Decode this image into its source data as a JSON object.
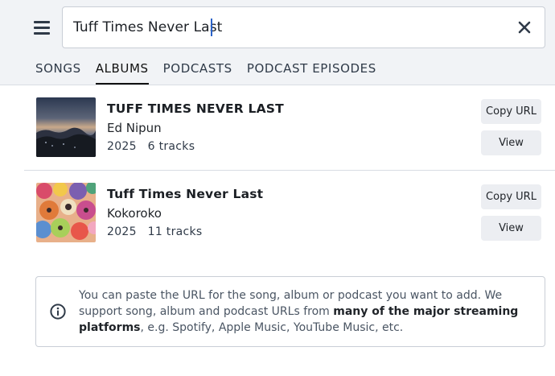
{
  "header": {
    "menu_icon": "hamburger-menu-icon",
    "search": {
      "value": "Tuff Times Never Last",
      "clear_icon": "close-icon"
    }
  },
  "tabs": [
    {
      "label": "SONGS",
      "active": false
    },
    {
      "label": "ALBUMS",
      "active": true
    },
    {
      "label": "PODCASTS",
      "active": false
    },
    {
      "label": "PODCAST EPISODES",
      "active": false
    }
  ],
  "results": [
    {
      "title": "TUFF TIMES NEVER LAST",
      "artist": "Ed Nipun",
      "year": "2025",
      "tracks": "6 tracks",
      "copy_label": "Copy URL",
      "view_label": "View"
    },
    {
      "title": "Tuff Times Never Last",
      "artist": "Kokoroko",
      "year": "2025",
      "tracks": "11 tracks",
      "copy_label": "Copy URL",
      "view_label": "View"
    }
  ],
  "info": {
    "icon": "info-circle-icon",
    "text_before": "You can paste the URL for the song, album or podcast you want to add. We support song, album and podcast URLs from ",
    "link_text": "many of the major streaming platforms",
    "text_after": ", e.g. Spotify, Apple Music, YouTube Music, etc."
  },
  "colors": {
    "header_bg": "#f1f3f6",
    "button_bg": "#eceef2",
    "caret": "#2a62c9"
  }
}
